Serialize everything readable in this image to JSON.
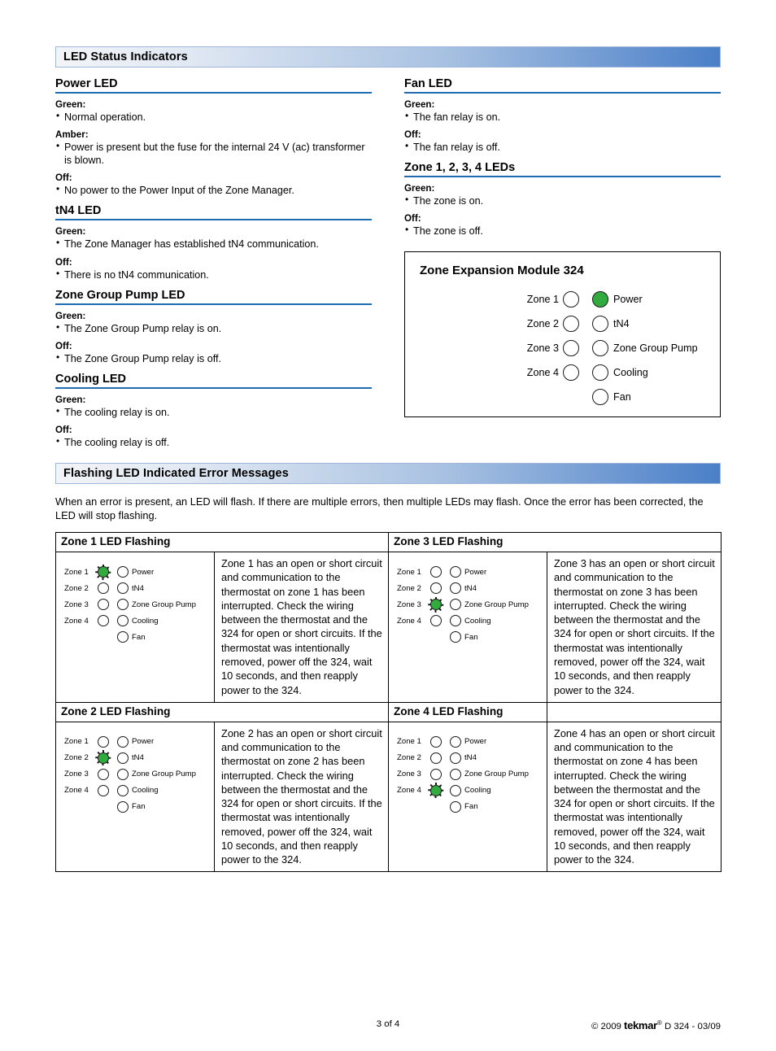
{
  "sections": {
    "led_status_title": "LED Status Indicators",
    "flashing_title": "Flashing LED Indicated Error Messages"
  },
  "left_column": [
    {
      "heading": "Power LED",
      "entries": [
        {
          "state": "Green:",
          "text": "Normal operation."
        },
        {
          "state": "Amber:",
          "text": "Power is present but the fuse for the internal 24 V (ac) transformer is blown."
        },
        {
          "state": "Off:",
          "text": "No power to the Power Input of the Zone Manager."
        }
      ]
    },
    {
      "heading": "tN4 LED",
      "entries": [
        {
          "state": "Green:",
          "text": "The Zone Manager has established tN4 communication."
        },
        {
          "state": "Off:",
          "text": "There is no tN4 communication."
        }
      ]
    },
    {
      "heading": "Zone Group Pump LED",
      "entries": [
        {
          "state": "Green:",
          "text": "The Zone Group Pump relay is on."
        },
        {
          "state": "Off:",
          "text": "The Zone Group Pump relay is off."
        }
      ]
    },
    {
      "heading": "Cooling LED",
      "entries": [
        {
          "state": "Green:",
          "text": "The cooling relay is on."
        },
        {
          "state": "Off:",
          "text": "The cooling relay is off."
        }
      ]
    }
  ],
  "right_column": [
    {
      "heading": "Fan LED",
      "entries": [
        {
          "state": "Green:",
          "text": "The fan relay is on."
        },
        {
          "state": "Off:",
          "text": "The fan relay is off."
        }
      ]
    },
    {
      "heading": "Zone 1, 2, 3, 4 LEDs",
      "entries": [
        {
          "state": "Green:",
          "text": "The zone is on."
        },
        {
          "state": "Off:",
          "text": "The zone is off."
        }
      ]
    }
  ],
  "module_diagram": {
    "title": "Zone Expansion Module 324",
    "zone_labels": [
      "Zone 1",
      "Zone 2",
      "Zone 3",
      "Zone 4"
    ],
    "zone_states": [
      "off",
      "off",
      "off",
      "off"
    ],
    "status_labels": [
      "Power",
      "tN4",
      "Zone Group Pump",
      "Cooling",
      "Fan"
    ],
    "status_states": [
      "on",
      "off",
      "off",
      "off",
      "off"
    ],
    "led_on_color": "#32ab3e",
    "led_off_color": "#ffffff"
  },
  "flashing_intro": "When an error is present, an LED will flash. If there are multiple errors, then multiple LEDs may flash. Once the error has been corrected, the LED will stop flashing.",
  "error_table": {
    "zone_labels": [
      "Zone 1",
      "Zone 2",
      "Zone 3",
      "Zone 4"
    ],
    "status_labels": [
      "Power",
      "tN4",
      "Zone Group Pump",
      "Cooling",
      "Fan"
    ],
    "cells": [
      {
        "header": "Zone 1 LED Flashing",
        "flashing_zone_index": 0,
        "description": "Zone 1 has an open or short circuit and communication to the thermostat on zone 1 has been interrupted. Check the wiring between the thermostat and the 324 for open or short circuits. If the thermostat was intentionally removed, power off the 324, wait 10 seconds, and then reapply power to the 324."
      },
      {
        "header": "Zone 3 LED Flashing",
        "flashing_zone_index": 2,
        "description": "Zone 3 has an open or short circuit and communication to the thermostat on zone 3 has been interrupted. Check the wiring between the thermostat and the 324 for open or short circuits. If the thermostat was intentionally removed, power off the 324, wait 10 seconds, and then reapply power to the 324."
      },
      {
        "header": "Zone 2 LED Flashing",
        "flashing_zone_index": 1,
        "description": "Zone 2 has an open or short circuit and communication to the thermostat on zone 2 has been interrupted. Check the wiring between the thermostat and the 324 for open or short circuits. If the thermostat was intentionally removed, power off the 324, wait 10 seconds, and then reapply power to the 324."
      },
      {
        "header": "Zone 4 LED Flashing",
        "flashing_zone_index": 3,
        "description": "Zone 4 has an open or short circuit and communication to the thermostat on zone 4 has been interrupted. Check the wiring between the thermostat and the 324 for open or short circuits. If the thermostat was intentionally removed, power off the 324, wait 10 seconds, and then reapply power to the 324."
      }
    ]
  },
  "footer": {
    "page": "3 of 4",
    "copyright": "© 2009",
    "brand": "tekmar",
    "registered": "®",
    "doc": "D 324 - 03/09"
  },
  "colors": {
    "banner_end": "#4a7fc8",
    "rule": "#1f6cb5",
    "led_green": "#32ab3e"
  }
}
